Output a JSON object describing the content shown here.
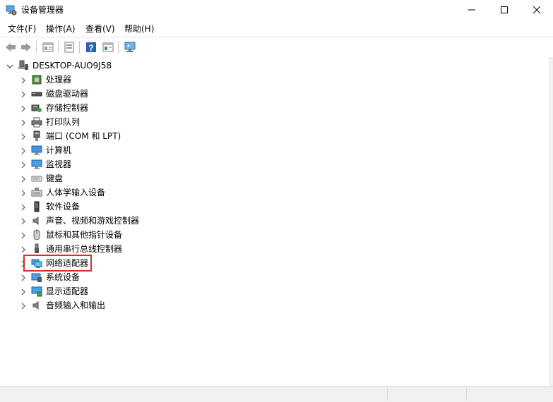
{
  "window": {
    "title": "设备管理器",
    "controls": {
      "minimize": "minimize-icon",
      "maximize": "maximize-icon",
      "close": "close-icon"
    }
  },
  "menu": [
    {
      "label": "文件(F)"
    },
    {
      "label": "操作(A)"
    },
    {
      "label": "查看(V)"
    },
    {
      "label": "帮助(H)"
    }
  ],
  "toolbar": {
    "buttons": [
      "back-icon",
      "forward-icon",
      "properties-icon",
      "console-icon",
      "help-icon",
      "view-icon",
      "scan-hardware-icon"
    ]
  },
  "tree": {
    "root": {
      "label": "DESKTOP-AUO9J58",
      "expanded": true
    },
    "items": [
      {
        "label": "处理器",
        "icon": "processor-icon"
      },
      {
        "label": "磁盘驱动器",
        "icon": "disk-drive-icon"
      },
      {
        "label": "存储控制器",
        "icon": "storage-controller-icon"
      },
      {
        "label": "打印队列",
        "icon": "print-queue-icon"
      },
      {
        "label": "端口 (COM 和 LPT)",
        "icon": "port-icon"
      },
      {
        "label": "计算机",
        "icon": "computer-icon"
      },
      {
        "label": "监视器",
        "icon": "monitor-icon"
      },
      {
        "label": "键盘",
        "icon": "keyboard-icon"
      },
      {
        "label": "人体学输入设备",
        "icon": "hid-icon"
      },
      {
        "label": "软件设备",
        "icon": "software-device-icon"
      },
      {
        "label": "声音、视频和游戏控制器",
        "icon": "sound-icon"
      },
      {
        "label": "鼠标和其他指针设备",
        "icon": "mouse-icon"
      },
      {
        "label": "通用串行总线控制器",
        "icon": "usb-icon"
      },
      {
        "label": "网络适配器",
        "icon": "network-adapter-icon",
        "highlighted": true
      },
      {
        "label": "系统设备",
        "icon": "system-device-icon"
      },
      {
        "label": "显示适配器",
        "icon": "display-adapter-icon"
      },
      {
        "label": "音频输入和输出",
        "icon": "audio-io-icon"
      }
    ]
  },
  "colors": {
    "highlight_border": "#e02b2b",
    "accent_blue": "#1e7fd0"
  }
}
